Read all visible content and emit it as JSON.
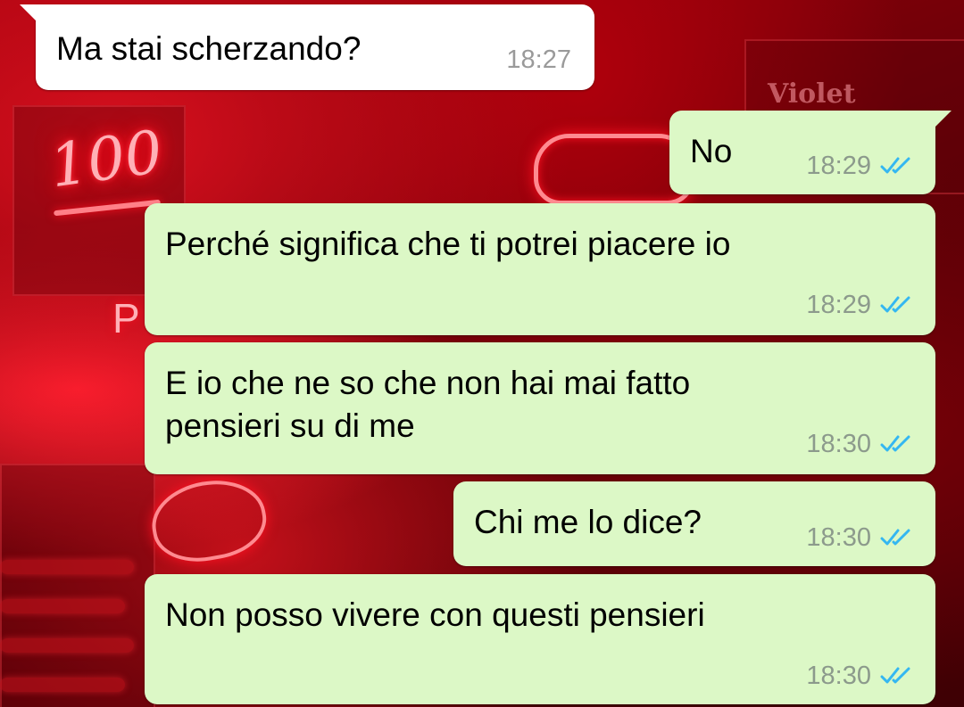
{
  "conversation": {
    "messages": [
      {
        "direction": "incoming",
        "text": "Ma stai scherzando?",
        "time": "18:27"
      },
      {
        "direction": "outgoing",
        "text": "No",
        "time": "18:29",
        "status": "read"
      },
      {
        "direction": "outgoing",
        "text": "Perché significa che ti potrei piacere io",
        "time": "18:29",
        "status": "read"
      },
      {
        "direction": "outgoing",
        "text": "E io che ne so che non hai mai fatto pensieri su di me",
        "time": "18:30",
        "status": "read"
      },
      {
        "direction": "outgoing",
        "text": "Chi me lo dice?",
        "time": "18:30",
        "status": "read"
      },
      {
        "direction": "outgoing",
        "text": "Non posso vivere con questi pensieri",
        "time": "18:30",
        "status": "read"
      }
    ]
  },
  "wallpaper": {
    "neon_number": "100",
    "neon_letter": "P",
    "sign_text": "Violet"
  },
  "colors": {
    "incoming_bubble": "#ffffff",
    "outgoing_bubble": "#dcf8c6",
    "read_ticks": "#34b7f1",
    "timestamp": "#8c9a8c"
  },
  "icons": {
    "read_status": "double-check-icon"
  }
}
